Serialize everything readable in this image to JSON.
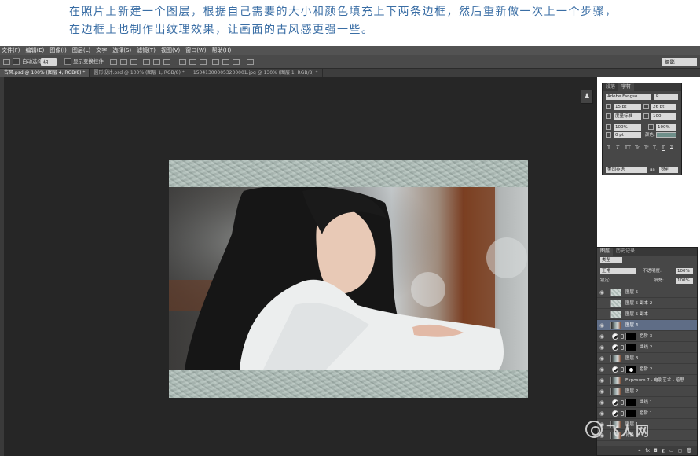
{
  "instruction": {
    "line1": "在照片上新建一个图层，根据自己需要的大小和颜色填充上下两条边框，然后重新做一次上一个步骤，",
    "line2": "在边框上也制作出纹理效果，让画面的古风感更强一些。"
  },
  "menubar": [
    "文件(F)",
    "编辑(E)",
    "图像(I)",
    "图层(L)",
    "文字",
    "选择(S)",
    "滤镜(T)",
    "视图(V)",
    "窗口(W)",
    "帮助(H)"
  ],
  "options_bar": {
    "auto_select_label": "自动选择:",
    "auto_select_value": "组",
    "show_transform_label": "显示变换控件",
    "workspace": "摄影"
  },
  "tabs": [
    {
      "label": "古风.psd @ 100% (图层 4, RGB/8) *",
      "active": true
    },
    {
      "label": "圆形设计.psd @ 100% (图层 1, RGB/8) *",
      "active": false
    },
    {
      "label": "150413000053230001.jpg @ 130% (图层 1, RGB/8) *",
      "active": false
    }
  ],
  "character_panel": {
    "tabs": [
      "段落",
      "字符"
    ],
    "font_family": "Adobe Fangso...",
    "font_style": "R",
    "font_size": "15 pt",
    "leading": "26 pt",
    "kerning": "度量标准",
    "tracking": "100",
    "vertical_scale": "100%",
    "horizontal_scale": "100%",
    "baseline_shift": "0 pt",
    "color_label": "颜色:",
    "style_buttons": [
      "T",
      "T",
      "TT",
      "Tr",
      "T'",
      "T,",
      "T",
      "T"
    ],
    "language": "美国英语",
    "antialias_label": "aa",
    "antialias": "锐利"
  },
  "layers_panel": {
    "tabs": [
      "图层",
      "历史记录"
    ],
    "filter_kind": "类型",
    "blend_mode": "正常",
    "opacity_label": "不透明度:",
    "opacity": "100%",
    "lock_label": "锁定:",
    "fill_label": "填充:",
    "fill": "100%",
    "layers": [
      {
        "name": "图层 5",
        "thumb": "grey",
        "visible": true,
        "adjustment": false,
        "selected": false
      },
      {
        "name": "图层 5 副本 2",
        "thumb": "grey",
        "visible": false,
        "adjustment": false,
        "selected": false
      },
      {
        "name": "图层 5 副本",
        "thumb": "grey",
        "visible": false,
        "adjustment": false,
        "selected": false
      },
      {
        "name": "图层 4",
        "thumb": "photo",
        "visible": true,
        "adjustment": false,
        "selected": true
      },
      {
        "name": "色阶 3",
        "thumb": "adj",
        "visible": true,
        "adjustment": true,
        "selected": false
      },
      {
        "name": "曲线 2",
        "thumb": "adj",
        "visible": true,
        "adjustment": true,
        "selected": false
      },
      {
        "name": "图层 3",
        "thumb": "photo",
        "visible": true,
        "adjustment": false,
        "selected": false
      },
      {
        "name": "色阶 2",
        "thumb": "adj",
        "visible": true,
        "adjustment": true,
        "selected": false,
        "mask_dot": true
      },
      {
        "name": "Exposure 7 - 电影艺术 - 暗思 正...",
        "thumb": "photo",
        "visible": true,
        "adjustment": false,
        "selected": false
      },
      {
        "name": "图层 2",
        "thumb": "photo",
        "visible": true,
        "adjustment": false,
        "selected": false
      },
      {
        "name": "曲线 1",
        "thumb": "adj",
        "visible": true,
        "adjustment": true,
        "selected": false
      },
      {
        "name": "色阶 1",
        "thumb": "adj",
        "visible": true,
        "adjustment": true,
        "selected": false
      },
      {
        "name": "图层 1",
        "thumb": "photo",
        "visible": true,
        "adjustment": false,
        "selected": false
      },
      {
        "name": "背景",
        "thumb": "photo",
        "visible": true,
        "adjustment": false,
        "selected": false
      }
    ],
    "footer_icons": [
      "link-icon",
      "fx-icon",
      "mask-icon",
      "adjustment-icon",
      "group-icon",
      "new-layer-icon",
      "trash-icon"
    ]
  },
  "watermark": "飞人网",
  "colors": {
    "instruction_text": "#3a6ea5",
    "workspace_bg": "#262626",
    "border_fill": "#a9b9b3",
    "text_color_swatch": "#6f8f8a",
    "selected_layer": "#5f6d86"
  }
}
